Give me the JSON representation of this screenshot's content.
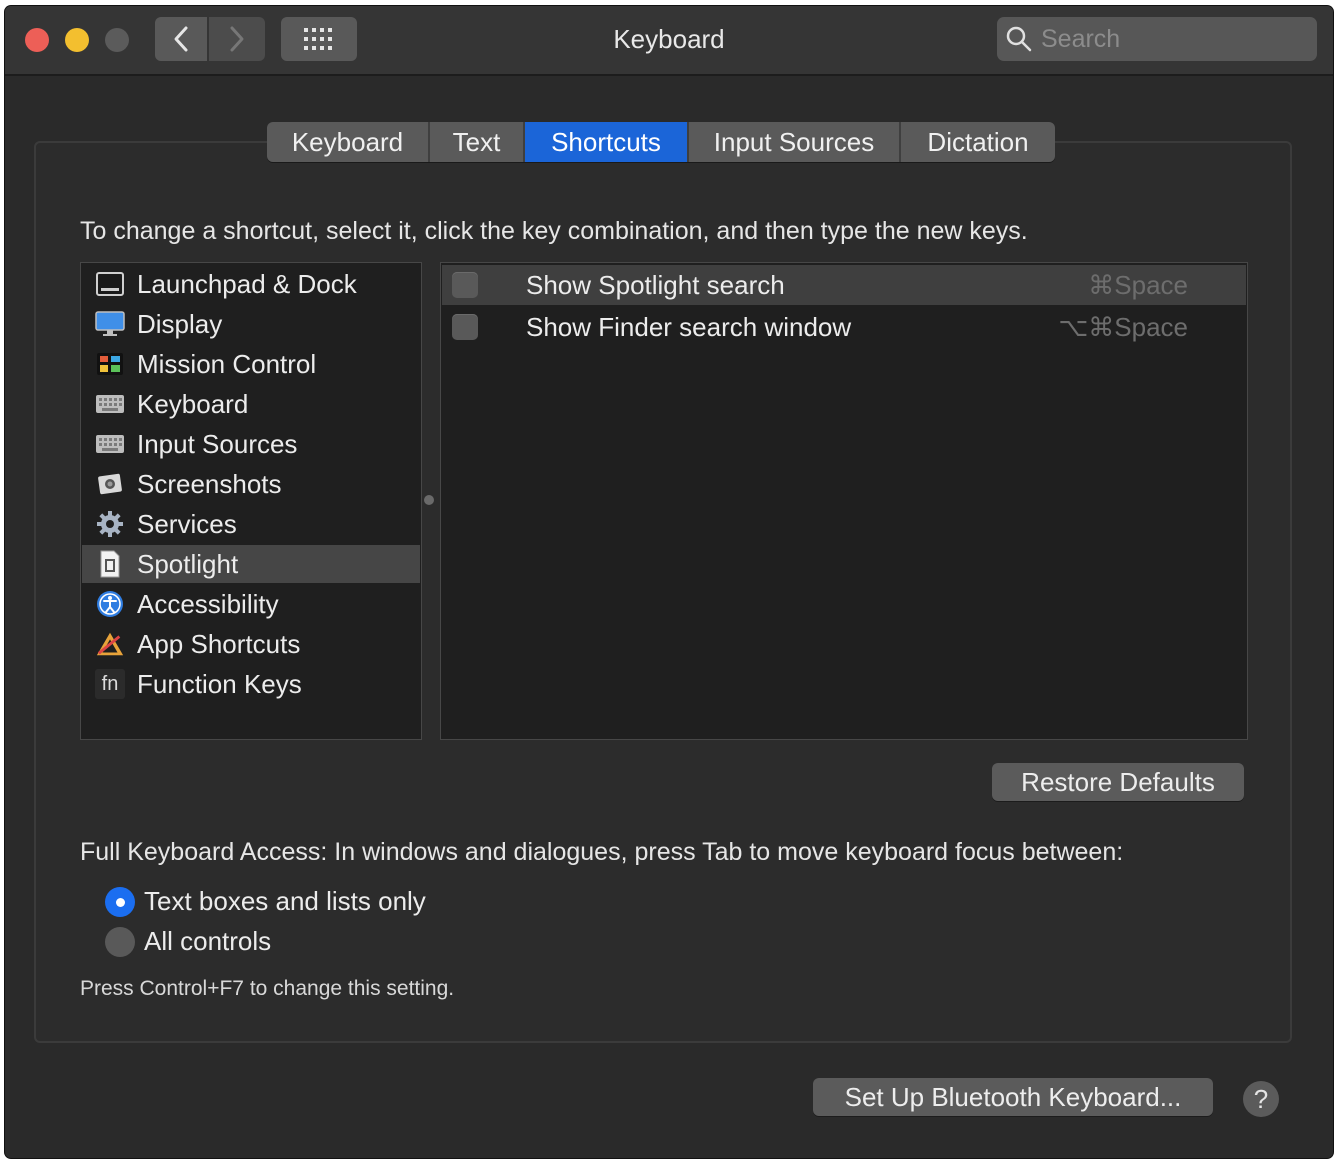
{
  "window": {
    "title": "Keyboard"
  },
  "search": {
    "placeholder": "Search",
    "icon": "magnifier-icon"
  },
  "tabs": [
    {
      "label": "Keyboard",
      "active": false
    },
    {
      "label": "Text",
      "active": false
    },
    {
      "label": "Shortcuts",
      "active": true
    },
    {
      "label": "Input Sources",
      "active": false
    },
    {
      "label": "Dictation",
      "active": false
    }
  ],
  "instruction": "To change a shortcut, select it, click the key combination, and then type the new keys.",
  "categories": [
    {
      "label": "Launchpad & Dock",
      "icon": "dock-icon"
    },
    {
      "label": "Display",
      "icon": "display-icon"
    },
    {
      "label": "Mission Control",
      "icon": "mission-control-icon"
    },
    {
      "label": "Keyboard",
      "icon": "keyboard-icon"
    },
    {
      "label": "Input Sources",
      "icon": "keyboard-icon"
    },
    {
      "label": "Screenshots",
      "icon": "screenshot-icon"
    },
    {
      "label": "Services",
      "icon": "gear-icon"
    },
    {
      "label": "Spotlight",
      "icon": "document-icon",
      "selected": true
    },
    {
      "label": "Accessibility",
      "icon": "accessibility-icon"
    },
    {
      "label": "App Shortcuts",
      "icon": "app-shortcuts-icon"
    },
    {
      "label": "Function Keys",
      "icon": "fn-icon",
      "icon_text": "fn"
    }
  ],
  "shortcuts": [
    {
      "label": "Show Spotlight search",
      "keys": "⌘Space",
      "checked": false,
      "selected": true
    },
    {
      "label": "Show Finder search window",
      "keys": "⌥⌘Space",
      "checked": false,
      "selected": false
    }
  ],
  "buttons": {
    "restore_defaults": "Restore Defaults",
    "bluetooth": "Set Up Bluetooth Keyboard...",
    "help": "?"
  },
  "keyboard_access": {
    "label": "Full Keyboard Access: In windows and dialogues, press Tab to move keyboard focus between:",
    "options": [
      {
        "label": "Text boxes and lists only",
        "selected": true
      },
      {
        "label": "All controls",
        "selected": false
      }
    ],
    "hint": "Press Control+F7 to change this setting."
  },
  "colors": {
    "accent": "#1b65d8",
    "window_bg": "#2a2a2a",
    "traffic_red": "#ed5f57",
    "traffic_yellow": "#f3bf2f",
    "traffic_inactive": "#5b5b5b"
  }
}
